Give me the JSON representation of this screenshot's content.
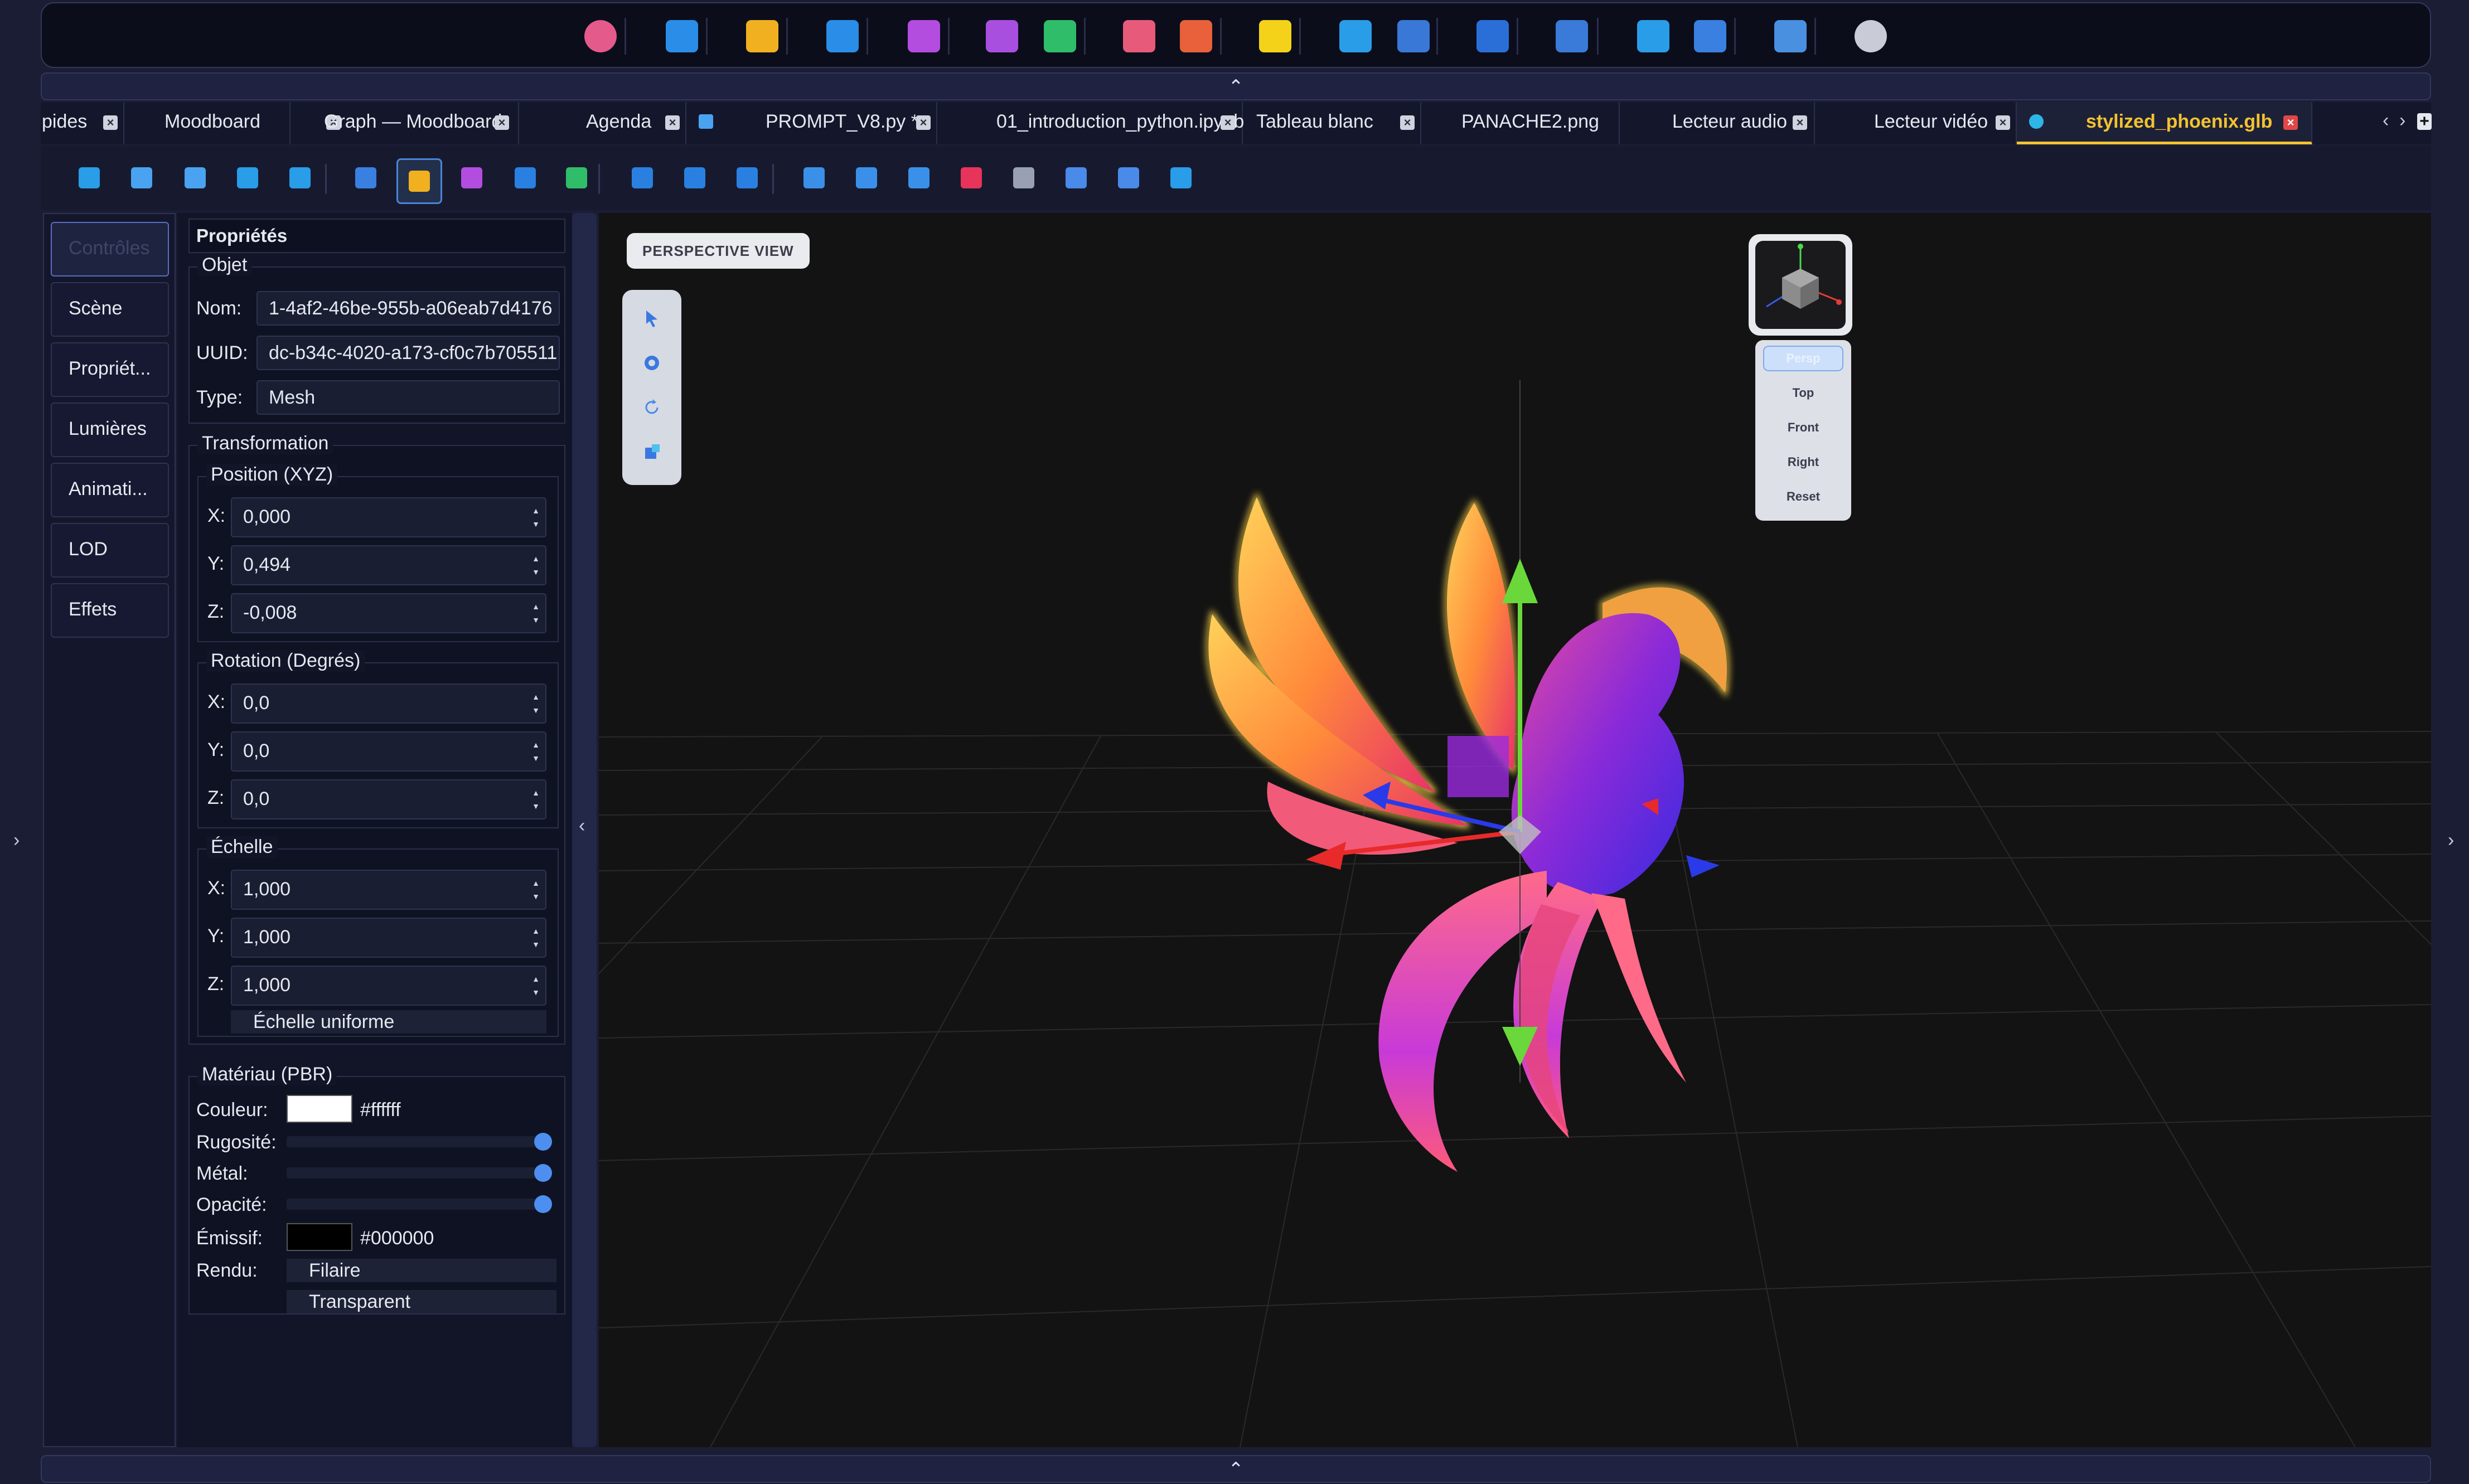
{
  "launcher": {
    "apps": [
      {
        "icon": "app-logo-icon",
        "color": "#e45a8a"
      },
      {
        "icon": "window-app-icon",
        "color": "#2a8de8"
      },
      {
        "icon": "moodboard-app-icon",
        "color": "#f0b020"
      },
      {
        "icon": "calendar-app-icon",
        "color": "#2a8de8"
      },
      {
        "icon": "presentation-app-icon",
        "color": "#b24de0"
      },
      {
        "icon": "document-app-icon",
        "color": "#a94fe0"
      },
      {
        "icon": "spreadsheet-app-icon",
        "color": "#2fbd6a"
      },
      {
        "icon": "pdf-app-icon",
        "color": "#e85a7a"
      },
      {
        "icon": "epub-app-icon",
        "color": "#e8613a"
      },
      {
        "icon": "sticky-note-app-icon",
        "color": "#f4d21a"
      },
      {
        "icon": "code-editor-app-icon",
        "color": "#2a9de8"
      },
      {
        "icon": "python-app-icon",
        "color": "#3a78d8"
      },
      {
        "icon": "whiteboard-app-icon",
        "color": "#2a6fd8"
      },
      {
        "icon": "image-viewer-app-icon",
        "color": "#3a7ad8"
      },
      {
        "icon": "audio-player-app-icon",
        "color": "#2a9de8"
      },
      {
        "icon": "video-player-app-icon",
        "color": "#3a80e0"
      },
      {
        "icon": "3d-viewer-app-icon",
        "color": "#4a90e0"
      },
      {
        "icon": "settings-app-icon",
        "color": "#c9ccd6"
      }
    ],
    "collapse_glyph": "⌃"
  },
  "tabs": [
    {
      "label": "pides",
      "active": false
    },
    {
      "label": "Moodboard",
      "active": false
    },
    {
      "label": "Graph — Moodboard",
      "active": false
    },
    {
      "label": "Agenda",
      "active": false
    },
    {
      "label": "PROMPT_V8.py *",
      "active": false
    },
    {
      "label": "01_introduction_python.ipynb",
      "active": false
    },
    {
      "label": "Tableau blanc",
      "active": false
    },
    {
      "label": "PANACHE2.png",
      "active": false
    },
    {
      "label": "Lecteur audio",
      "active": false
    },
    {
      "label": "Lecteur vidéo",
      "active": false
    },
    {
      "label": "stylized_phoenix.glb",
      "active": true
    }
  ],
  "tab_close_glyph": "×",
  "tab_scroll": {
    "left": "‹",
    "right": "›",
    "add": "+"
  },
  "toolbar": {
    "tools": [
      "zoom-fit-icon",
      "undo-icon",
      "redo-icon",
      "zoom-in-icon",
      "zoom-out-icon",
      "grid-edit-icon",
      "texture-icon",
      "grid-icon",
      "plane-icon",
      "line-icon",
      "play-icon",
      "pause-icon",
      "stop-icon",
      "save-icon",
      "save-as-icon",
      "screenshot-icon",
      "export-icon",
      "settings-icon",
      "hand-pan-icon",
      "refresh-icon",
      "fullscreen-icon"
    ]
  },
  "nav": [
    {
      "label": "Contrôles",
      "active": true
    },
    {
      "label": "Scène",
      "active": false
    },
    {
      "label": "Propriét...",
      "active": false
    },
    {
      "label": "Lumières",
      "active": false
    },
    {
      "label": "Animati...",
      "active": false
    },
    {
      "label": "LOD",
      "active": false
    },
    {
      "label": "Effets",
      "active": false
    }
  ],
  "properties": {
    "header": "Propriétés",
    "object": {
      "title": "Objet",
      "name_label": "Nom:",
      "name_value": "1-4af2-46be-955b-a06eab7d4176",
      "uuid_label": "UUID:",
      "uuid_value": "dc-b34c-4020-a173-cf0c7b705511",
      "type_label": "Type:",
      "type_value": "Mesh"
    },
    "transform": {
      "title": "Transformation",
      "position": {
        "title": "Position (XYZ)",
        "x": "0,000",
        "y": "0,494",
        "z": "-0,008"
      },
      "rotation": {
        "title": "Rotation (Degrés)",
        "x": "0,0",
        "y": "0,0",
        "z": "0,0"
      },
      "scale": {
        "title": "Échelle",
        "x": "1,000",
        "y": "1,000",
        "z": "1,000",
        "uniform": "Échelle uniforme"
      },
      "axis_x": "X:",
      "axis_y": "Y:",
      "axis_z": "Z:"
    },
    "material": {
      "title": "Matériau (PBR)",
      "color_label": "Couleur:",
      "color_value": "#ffffff",
      "roughness_label": "Rugosité:",
      "roughness": 1.0,
      "metal_label": "Métal:",
      "metal": 1.0,
      "opacity_label": "Opacité:",
      "opacity": 1.0,
      "emissive_label": "Émissif:",
      "emissive_value": "#000000",
      "render_label": "Rendu:",
      "wireframe": "Filaire",
      "transparent": "Transparent"
    }
  },
  "viewport": {
    "view_label": "PERSPECTIVE VIEW",
    "side_tools": [
      "select-cursor-icon",
      "orbit-icon",
      "rotate-icon",
      "scale-icon"
    ],
    "view_buttons": [
      {
        "label": "Persp",
        "active": true
      },
      {
        "label": "Top",
        "active": false
      },
      {
        "label": "Front",
        "active": false
      },
      {
        "label": "Right",
        "active": false
      },
      {
        "label": "Reset",
        "active": false
      }
    ],
    "background": "#131313"
  },
  "rails": {
    "left": "›",
    "right": "›",
    "splitter": "‹"
  }
}
